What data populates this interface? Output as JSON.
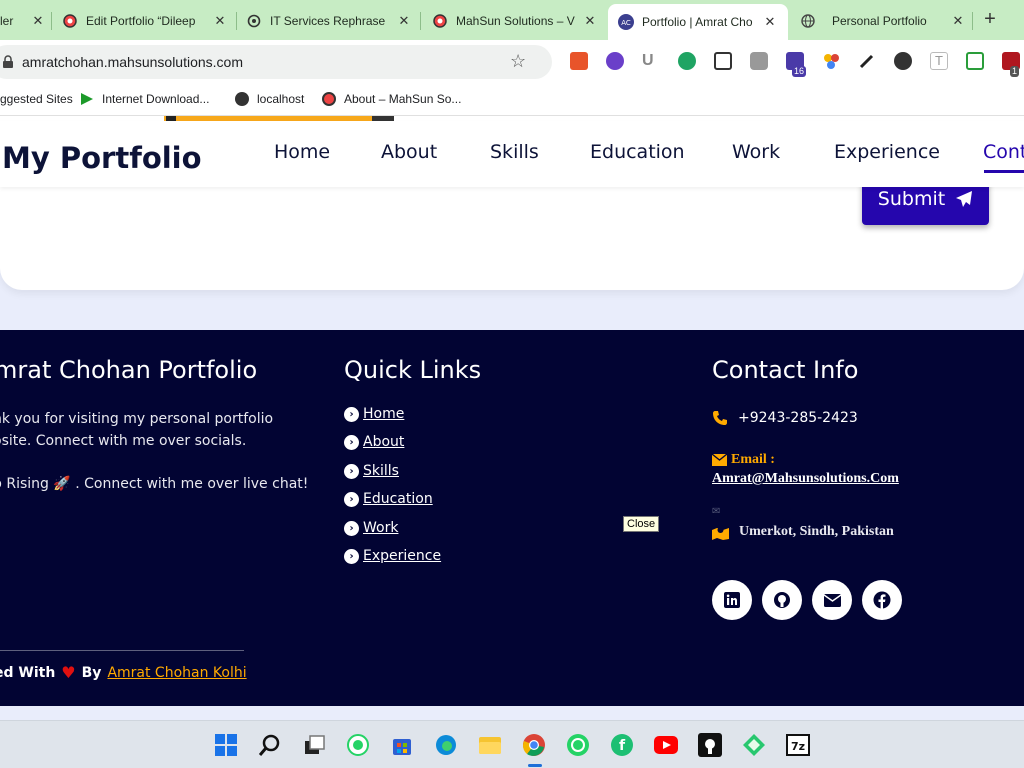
{
  "browser": {
    "tabs": [
      {
        "title": "ler",
        "favicon": "chrome-icon"
      },
      {
        "title": "Edit Portfolio “Dileep",
        "favicon": "wordpress-icon"
      },
      {
        "title": "IT Services Rephrase",
        "favicon": "openai-icon"
      },
      {
        "title": "MahSun Solutions – V",
        "favicon": "wordpress-icon"
      },
      {
        "title": "Portfolio | Amrat Cho",
        "favicon": "ac-icon",
        "active": true
      },
      {
        "title": "Personal Portfolio",
        "favicon": "globe-icon"
      }
    ],
    "new_tab_label": "+",
    "url": "amratchohan.mahsunsolutions.com",
    "extension_badge": "16",
    "extension_badge2": "1",
    "bookmarks": [
      {
        "label": "ggested Sites"
      },
      {
        "label": "Internet Download..."
      },
      {
        "label": "localhost"
      },
      {
        "label": "About – MahSun So..."
      }
    ]
  },
  "site": {
    "logo": "My Portfolio",
    "nav": [
      "Home",
      "About",
      "Skills",
      "Education",
      "Work",
      "Experience",
      "Cont"
    ],
    "active_nav": "Cont",
    "submit_label": "Submit"
  },
  "footer": {
    "about_title": "mrat Chohan Portfolio",
    "about_text": "nk you for visiting my personal portfolio osite. Connect with me over socials.",
    "about_text2": "p Rising 🚀 . Connect with me over live chat!",
    "links_title": "Quick Links",
    "links": [
      " Home",
      " About",
      " Skills",
      " Education",
      " Work",
      " Experience"
    ],
    "contact_title": "Contact Info",
    "phone": "+9243-285-2423",
    "email_label": "Email :",
    "email": "Amrat@Mahsunsolutions.Com",
    "location": "Umerkot, Sindh, Pakistan",
    "social": [
      "linkedin-icon",
      "github-icon",
      "envelope-icon",
      "facebook-icon"
    ],
    "credits_prefix": "ed With",
    "credits_by": "By",
    "credits_author": "Amrat Chohan Kolhi",
    "close_tooltip": "Close"
  },
  "colors": {
    "tabstrip": "#c7ecc4",
    "brand_blue": "#2506ad",
    "footer_bg": "#020433",
    "accent_orange": "#ffaa00",
    "heart_red": "#e01010"
  }
}
